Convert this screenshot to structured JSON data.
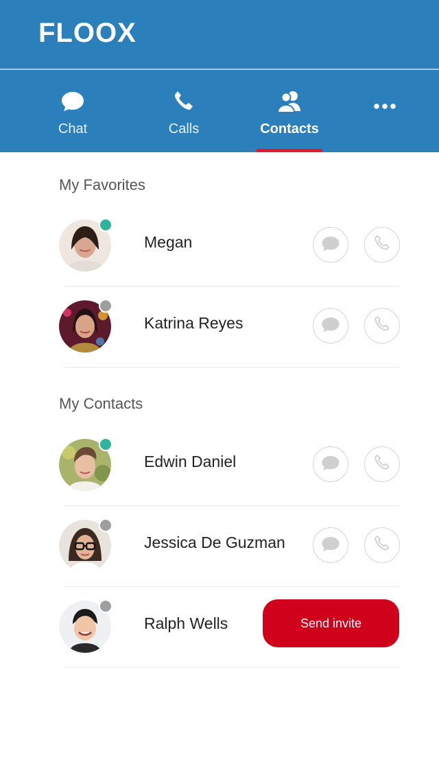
{
  "app": {
    "brand": "FLOOX"
  },
  "tabs": [
    {
      "label": "Chat",
      "icon": "chat-bubble-icon",
      "active": false
    },
    {
      "label": "Calls",
      "icon": "phone-icon",
      "active": false
    },
    {
      "label": "Contacts",
      "icon": "contacts-icon",
      "active": true
    },
    {
      "label": "",
      "icon": "more-dots-icon",
      "active": false
    }
  ],
  "sections": {
    "favorites_title": "My Favorites",
    "contacts_title": "My Contacts"
  },
  "favorites": [
    {
      "name": "Megan",
      "status": "online"
    },
    {
      "name": "Katrina Reyes",
      "status": "offline"
    }
  ],
  "contacts": [
    {
      "name": "Edwin Daniel",
      "status": "online"
    },
    {
      "name": "Jessica De Guzman",
      "status": "offline"
    },
    {
      "name": "Ralph Wells",
      "status": "offline",
      "invite_label": "Send invite"
    }
  ],
  "colors": {
    "header": "#2b7fbb",
    "accent_red": "#d0021b",
    "online": "#2fb39a",
    "offline": "#9e9e9e"
  }
}
